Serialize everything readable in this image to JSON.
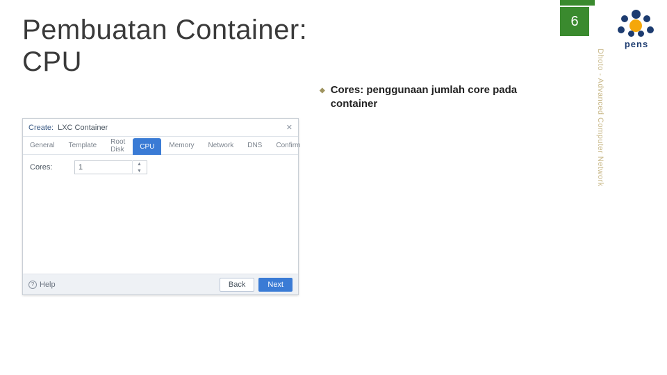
{
  "slide": {
    "title_line1": "Pembuatan Container:",
    "title_line2": "CPU",
    "page_number": "6",
    "side_credit": "Dhoto - Advanced Computer Network"
  },
  "logo": {
    "text": "pens"
  },
  "bullet": {
    "marker": "◆",
    "text": "Cores: penggunaan jumlah core pada container"
  },
  "dialog": {
    "header_action": "Create:",
    "header_title": "LXC Container",
    "close": "✕",
    "tabs": [
      "General",
      "Template",
      "Root Disk",
      "CPU",
      "Memory",
      "Network",
      "DNS",
      "Confirm"
    ],
    "active_tab_index": 3,
    "form": {
      "cores_label": "Cores:",
      "cores_value": "1"
    },
    "help_label": "Help",
    "back_label": "Back",
    "next_label": "Next"
  }
}
